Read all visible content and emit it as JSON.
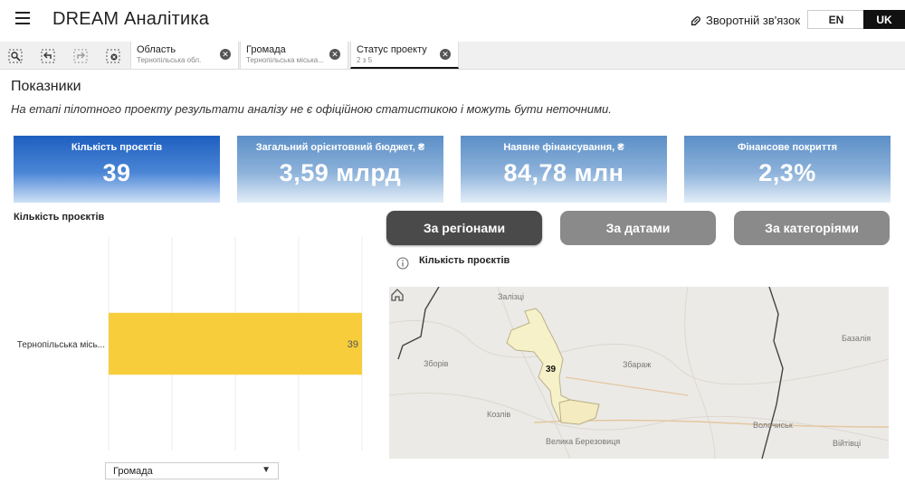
{
  "header": {
    "title": "DREAM Аналітика",
    "feedback": "Зворотній зв'язок",
    "lang_en": "EN",
    "lang_uk": "UK"
  },
  "filters": [
    {
      "label": "Область",
      "value": "Тернопільська обл."
    },
    {
      "label": "Громада",
      "value": "Тернопільська міська..."
    },
    {
      "label": "Статус проекту",
      "value": "2 з 5"
    }
  ],
  "section": {
    "title": "Показники",
    "disclaimer": "На етапі пілотного проекту результати аналізу не є офіційною статистикою і можуть бути неточними."
  },
  "kpis": [
    {
      "label": "Кількість проєктів",
      "value": "39"
    },
    {
      "label": "Загальний орієнтовний бюджет, ₴",
      "value": "3,59 млрд"
    },
    {
      "label": "Наявне фінансування, ₴",
      "value": "84,78 млн"
    },
    {
      "label": "Фінансове покриття",
      "value": "2,3%"
    }
  ],
  "bar_chart": {
    "title": "Кількість проєктів",
    "dropdown_value": "Громада"
  },
  "chart_data": {
    "type": "bar",
    "orientation": "horizontal",
    "categories": [
      "Тернопільська місь..."
    ],
    "values": [
      39
    ],
    "data_labels": [
      "39"
    ],
    "xlim": [
      0,
      39
    ],
    "grid": true,
    "color": "#f7cd3c"
  },
  "toggles": {
    "regions": "За регіонами",
    "dates": "За датами",
    "categories": "За категоріями"
  },
  "map": {
    "title": "Кількість проєктів",
    "count": "39",
    "places": [
      "Залізці",
      "Зборів",
      "Збараж",
      "Базалія",
      "Козлів",
      "Волочиськ",
      "Велика Березовиця",
      "Війтівці"
    ]
  },
  "colors": {
    "accent_dark": "#111111",
    "bar": "#f7cd3c",
    "active_toggle": "#4a4a4a",
    "inactive_toggle": "#8a8a8a",
    "kpi_primary": "#1e5fbf"
  }
}
